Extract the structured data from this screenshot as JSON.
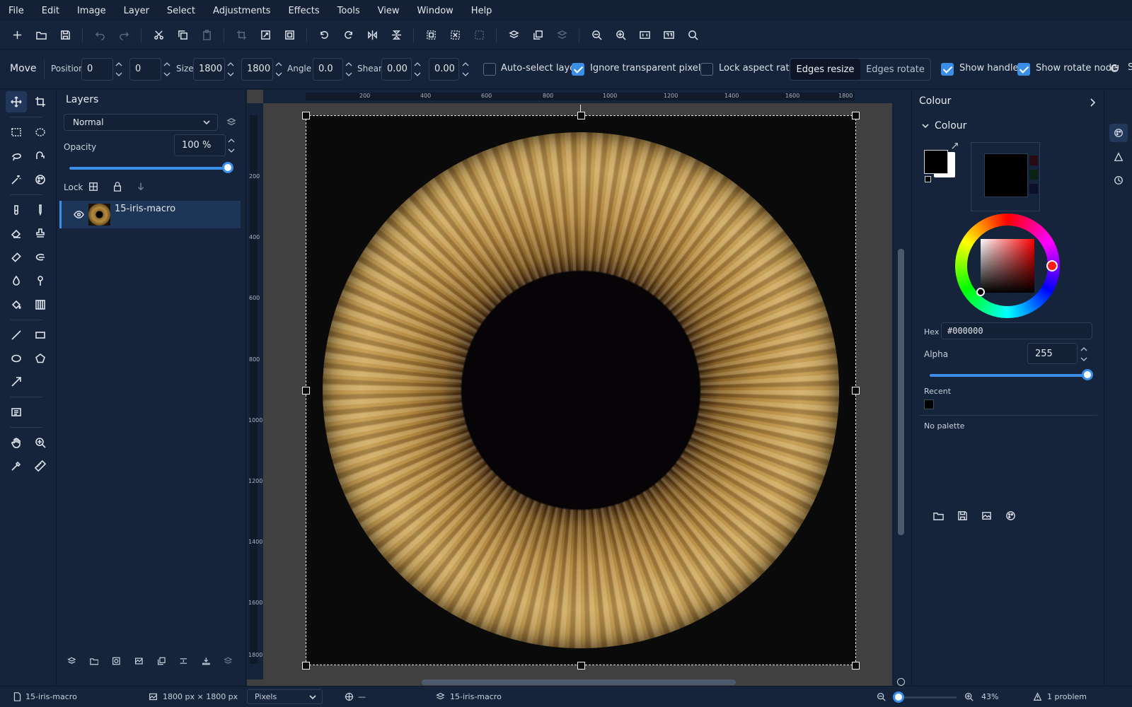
{
  "menu": [
    "File",
    "Edit",
    "Image",
    "Layer",
    "Select",
    "Adjustments",
    "Effects",
    "Tools",
    "View",
    "Window",
    "Help"
  ],
  "tool_options": {
    "tool_name": "Move",
    "position_label": "Position",
    "position_x": "0",
    "position_y": "0",
    "size_label": "Size",
    "size_w": "1800",
    "size_h": "1800",
    "angle_label": "Angle",
    "angle": "0.0",
    "shear_label": "Shear",
    "shear_x": "0.00",
    "shear_y": "0.00",
    "auto_select_label": "Auto-select layer",
    "auto_select_checked": false,
    "ignore_transparent_label": "Ignore transparent pixels",
    "ignore_transparent_checked": true,
    "lock_aspect_label": "Lock aspect ratio",
    "lock_aspect_checked": false,
    "edges_resize_label": "Edges resize",
    "edges_rotate_label": "Edges rotate",
    "active_edge_mode": "Edges resize",
    "show_handles_label": "Show handles",
    "show_handles_checked": true,
    "show_rotate_node_label": "Show rotate node",
    "show_rotate_node_checked": true
  },
  "layers_panel": {
    "title": "Layers",
    "blend_mode": "Normal",
    "opacity_label": "Opacity",
    "opacity_value": "100 %",
    "opacity_fraction": 1.0,
    "lock_label": "Lock",
    "layers": [
      {
        "name": "15-iris-macro",
        "visible": true,
        "selected": true
      }
    ]
  },
  "canvas": {
    "ruler_h_ticks": [
      "200",
      "400",
      "600",
      "800",
      "1000",
      "1200",
      "1400",
      "1600",
      "1800"
    ],
    "ruler_v_ticks": [
      "200",
      "400",
      "600",
      "800",
      "1000",
      "1200",
      "1400",
      "1600",
      "1800"
    ]
  },
  "colour_panel": {
    "title": "Colour",
    "section_title": "Colour",
    "foreground": "#000000",
    "background": "#ffffff",
    "hue_color": "#ff0000",
    "hex_label": "Hex",
    "hex_value": "#000000",
    "alpha_label": "Alpha",
    "alpha_value": "255",
    "recent_label": "Recent",
    "recent_colors": [
      "#000000"
    ],
    "palette_label": "No palette"
  },
  "status_bar": {
    "document": "15-iris-macro",
    "dimensions": "1800 px × 1800 px",
    "units": "Pixels",
    "cursor_position": "—",
    "layer": "15-iris-macro",
    "zoom": "43%",
    "problems": "1 problem"
  },
  "colors": {
    "accent": "#3b8fe8",
    "panel_bg": "#16243b",
    "canvas_bg": "#404040"
  }
}
